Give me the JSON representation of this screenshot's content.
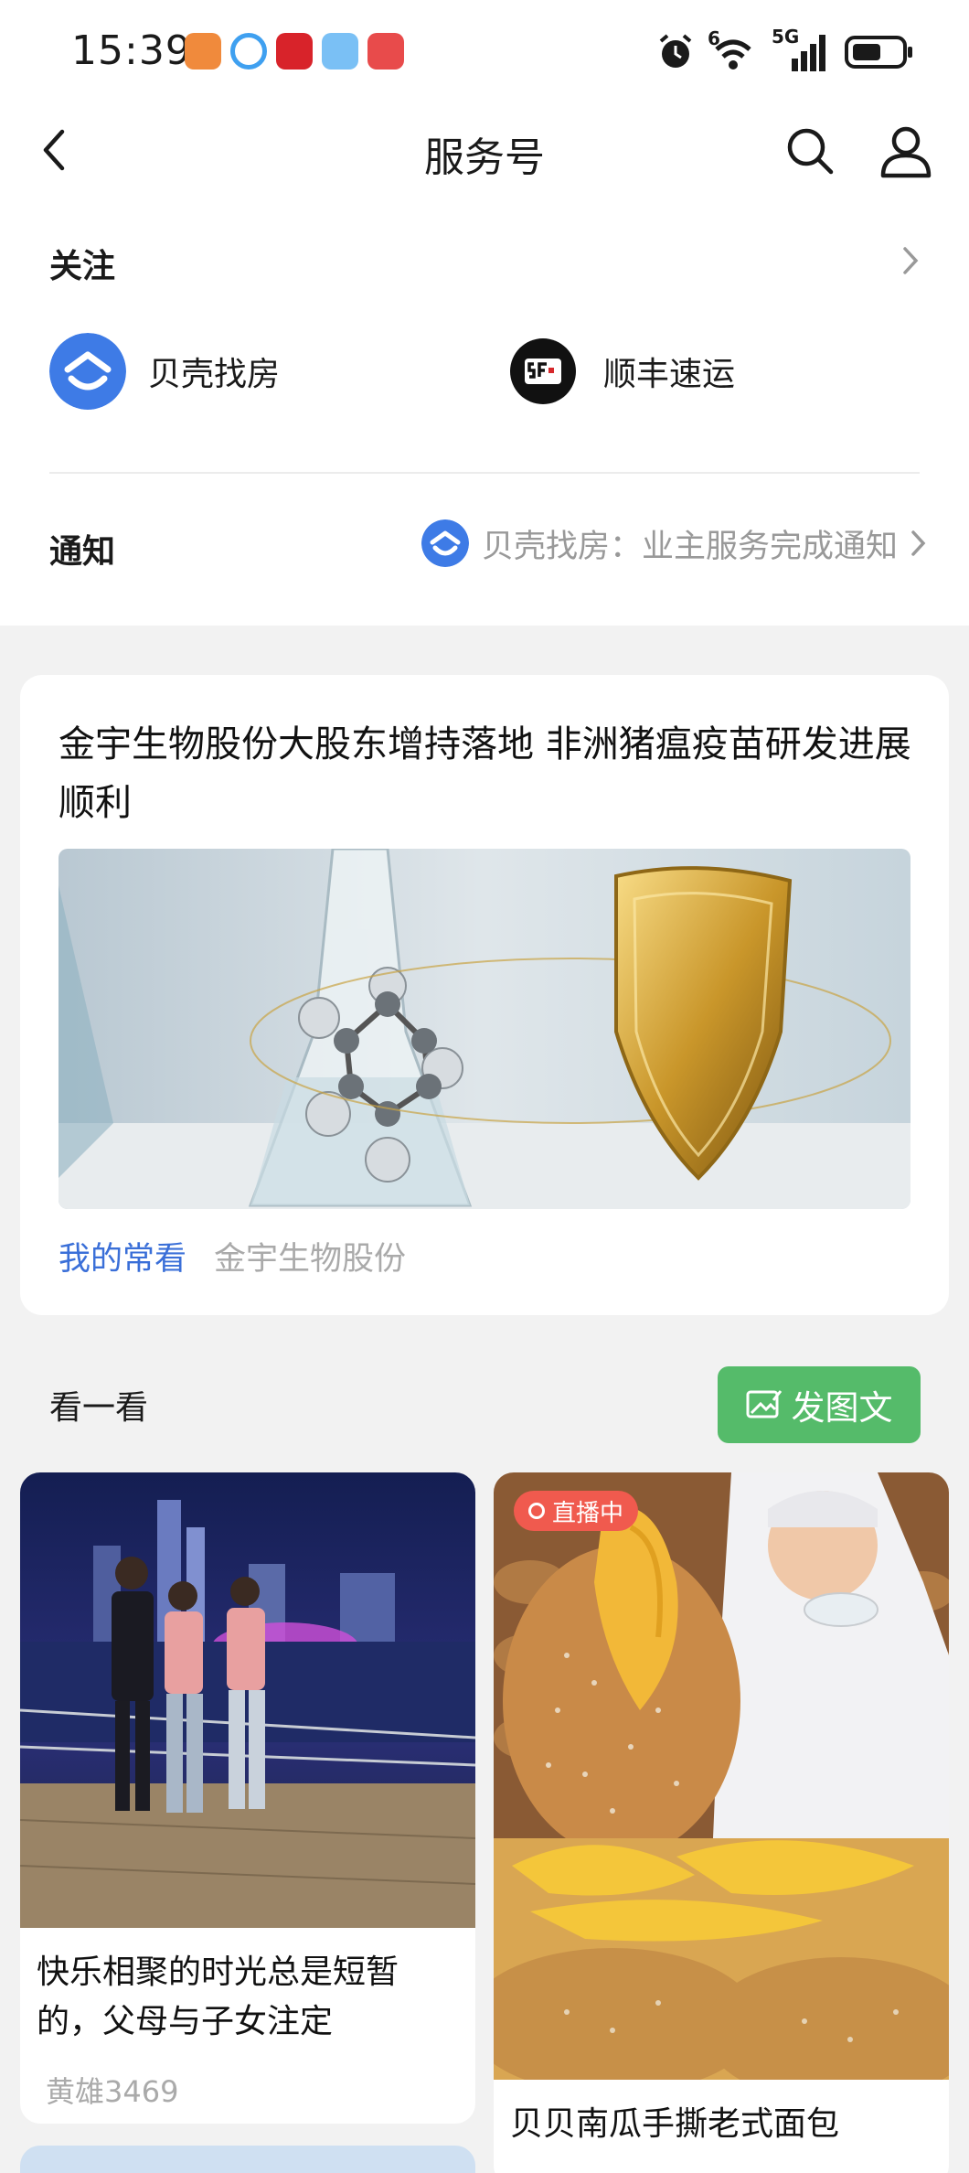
{
  "status_bar": {
    "time": "15:39",
    "network_label": "5G",
    "wifi_label": "6",
    "icons": [
      "alarm-icon",
      "wifi-icon",
      "signal-icon",
      "battery-icon"
    ]
  },
  "nav": {
    "title": "服务号",
    "back_icon": "chevron-left-icon",
    "search_icon": "search-icon",
    "profile_icon": "user-icon"
  },
  "follow": {
    "title": "关注",
    "accounts": [
      {
        "name": "贝壳找房",
        "logo": "beike-logo"
      },
      {
        "name": "顺丰速运",
        "logo": "sf-logo"
      }
    ]
  },
  "notification": {
    "title": "通知",
    "text": "贝壳找房：业主服务完成通知"
  },
  "article": {
    "title": "金宇生物股份大股东增持落地  非洲猪瘟疫苗研发进展顺利",
    "tag": "我的常看",
    "source": "金宇生物股份"
  },
  "look": {
    "title": "看一看",
    "post_button": "发图文"
  },
  "feed": [
    {
      "title": "快乐相聚的时光总是短暂的，父母与子女注定",
      "author": "黄雄3469",
      "live": ""
    },
    {
      "title": "贝贝南瓜手撕老式面包",
      "author": "",
      "live": "直播中"
    }
  ],
  "colors": {
    "accent_blue": "#3a6fd8",
    "green_button": "#55bb6a",
    "live_red": "#f05a4e"
  }
}
